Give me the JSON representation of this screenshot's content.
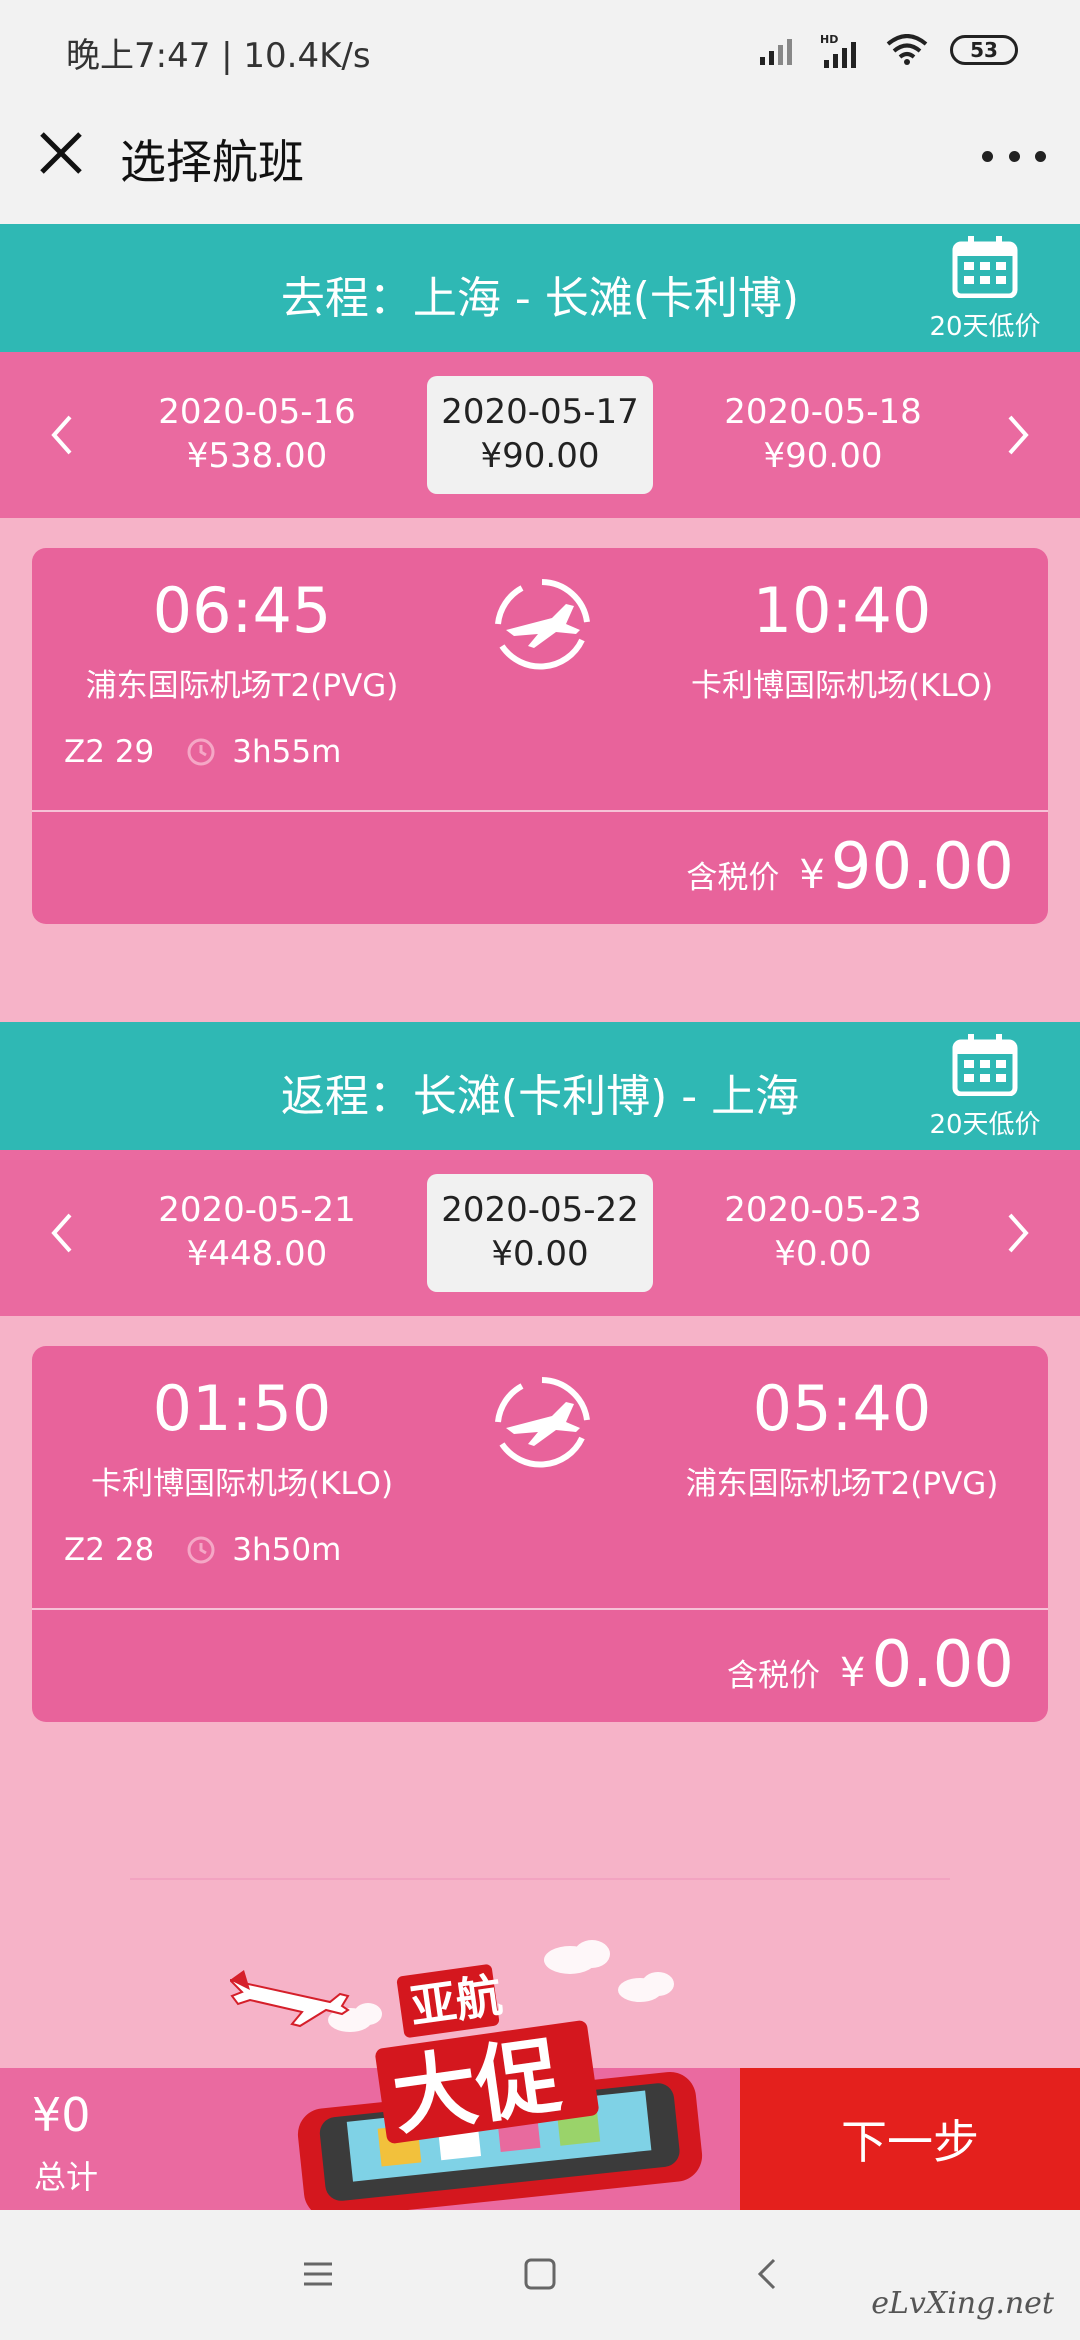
{
  "status_bar": {
    "time_speed": "晚上7:47 | 10.4K/s",
    "hd_label": "HD",
    "battery": "53"
  },
  "header": {
    "title": "选择航班"
  },
  "outbound": {
    "route_title": "去程：上海 - 长滩(卡利博)",
    "calendar_label": "20天低价",
    "dates": [
      {
        "date": "2020-05-16",
        "price": "¥538.00"
      },
      {
        "date": "2020-05-17",
        "price": "¥90.00"
      },
      {
        "date": "2020-05-18",
        "price": "¥90.00"
      }
    ],
    "flight": {
      "depart_time": "06:45",
      "depart_airport": "浦东国际机场T2(PVG)",
      "arrive_time": "10:40",
      "arrive_airport": "卡利博国际机场(KLO)",
      "flight_no": "Z2 29",
      "duration": "3h55m",
      "price_label": "含税价",
      "currency": "¥",
      "price": "90.00"
    }
  },
  "return": {
    "route_title": "返程：长滩(卡利博) - 上海",
    "calendar_label": "20天低价",
    "dates": [
      {
        "date": "2020-05-21",
        "price": "¥448.00"
      },
      {
        "date": "2020-05-22",
        "price": "¥0.00"
      },
      {
        "date": "2020-05-23",
        "price": "¥0.00"
      }
    ],
    "flight": {
      "depart_time": "01:50",
      "depart_airport": "卡利博国际机场(KLO)",
      "arrive_time": "05:40",
      "arrive_airport": "浦东国际机场T2(PVG)",
      "flight_no": "Z2 28",
      "duration": "3h50m",
      "price_label": "含税价",
      "currency": "¥",
      "price": "0.00"
    }
  },
  "promo": {
    "line1": "亚航",
    "line2": "大促"
  },
  "footer": {
    "total_amount": "¥0",
    "total_label": "总计",
    "next_button": "下一步"
  },
  "watermark": "eLvXing.net",
  "colors": {
    "teal": "#2fb8b4",
    "pink": "#ea6aa0",
    "card_pink": "#e8639b",
    "background": "#f6b3c8",
    "next_red": "#e4201d"
  }
}
